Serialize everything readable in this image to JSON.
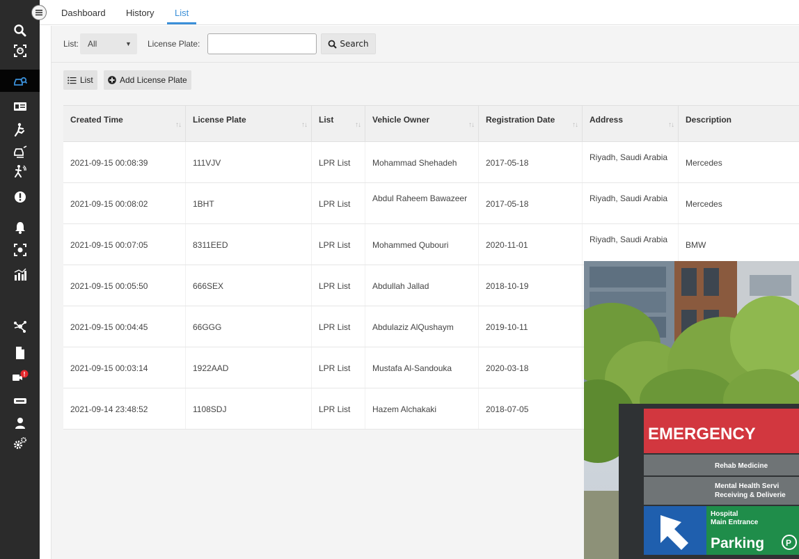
{
  "sidebar": {
    "items": [
      {
        "icon": "search-icon"
      },
      {
        "icon": "face-scan-icon"
      },
      {
        "icon": "car-search-icon",
        "active": true
      },
      {
        "icon": "id-card-icon"
      },
      {
        "icon": "running-person-icon"
      },
      {
        "icon": "car-alert-icon"
      },
      {
        "icon": "intrusion-icon"
      },
      {
        "icon": "alert-circle-icon"
      },
      {
        "icon": "bell-icon"
      },
      {
        "icon": "camera-scan-icon"
      },
      {
        "icon": "statistics-icon"
      },
      {
        "icon": "network-icon"
      },
      {
        "icon": "file-icon"
      },
      {
        "icon": "video-camera-alert-icon"
      },
      {
        "icon": "device-icon"
      },
      {
        "icon": "user-icon"
      },
      {
        "icon": "settings-gears-icon"
      }
    ],
    "alert_badge": "!"
  },
  "tabs": [
    {
      "label": "Dashboard",
      "active": false
    },
    {
      "label": "History",
      "active": false
    },
    {
      "label": "List",
      "active": true
    }
  ],
  "filters": {
    "list_label": "List:",
    "list_value": "All",
    "plate_label": "License Plate:",
    "plate_value": "",
    "search_label": "Search"
  },
  "actions": {
    "list_label": "List",
    "add_label": "Add License Plate"
  },
  "table": {
    "columns": [
      "Created Time",
      "License Plate",
      "List",
      "Vehicle Owner",
      "Registration Date",
      "Address",
      "Description"
    ],
    "rows": [
      [
        "2021-09-15 00:08:39",
        "111VJV",
        "LPR List",
        "Mohammad Shehadeh",
        "2017-05-18",
        "Riyadh, Saudi Arabia",
        "Mercedes"
      ],
      [
        "2021-09-15 00:08:02",
        "1BHT",
        "LPR List",
        "Abdul Raheem Bawazeer",
        "2017-05-18",
        "Riyadh, Saudi Arabia",
        "Mercedes"
      ],
      [
        "2021-09-15 00:07:05",
        "8311EED",
        "LPR List",
        "Mohammed Qubouri",
        "2020-11-01",
        "Riyadh, Saudi Arabia",
        "BMW"
      ],
      [
        "2021-09-15 00:05:50",
        "666SEX",
        "LPR List",
        "Abdullah Jallad",
        "2018-10-19",
        "",
        ""
      ],
      [
        "2021-09-15 00:04:45",
        "66GGG",
        "LPR List",
        "Abdulaziz AlQushaym",
        "2019-10-11",
        "",
        ""
      ],
      [
        "2021-09-15 00:03:14",
        "1922AAD",
        "LPR List",
        "Mustafa Al-Sandouka",
        "2020-03-18",
        "",
        ""
      ],
      [
        "2021-09-14 23:48:52",
        "1108SDJ",
        "LPR List",
        "Hazem Alchakaki",
        "2018-07-05",
        "",
        ""
      ]
    ]
  },
  "overlay_photo": {
    "sign_title": "EMERGENCY",
    "sign_line1": "Rehab Medicine",
    "sign_line2": "Mental Health Servi",
    "sign_line3": "Receiving & Deliverie",
    "sign_line4": "Hospital",
    "sign_line5": "Main Entrance",
    "sign_line6": "Parking",
    "sign_parking_symbol": "P"
  },
  "colors": {
    "sidebar_bg": "#2b2b2b",
    "accent": "#3a8fd8",
    "emergency_red": "#d2373f",
    "parking_blue": "#1f5fae",
    "parking_green": "#1f8d4a"
  }
}
